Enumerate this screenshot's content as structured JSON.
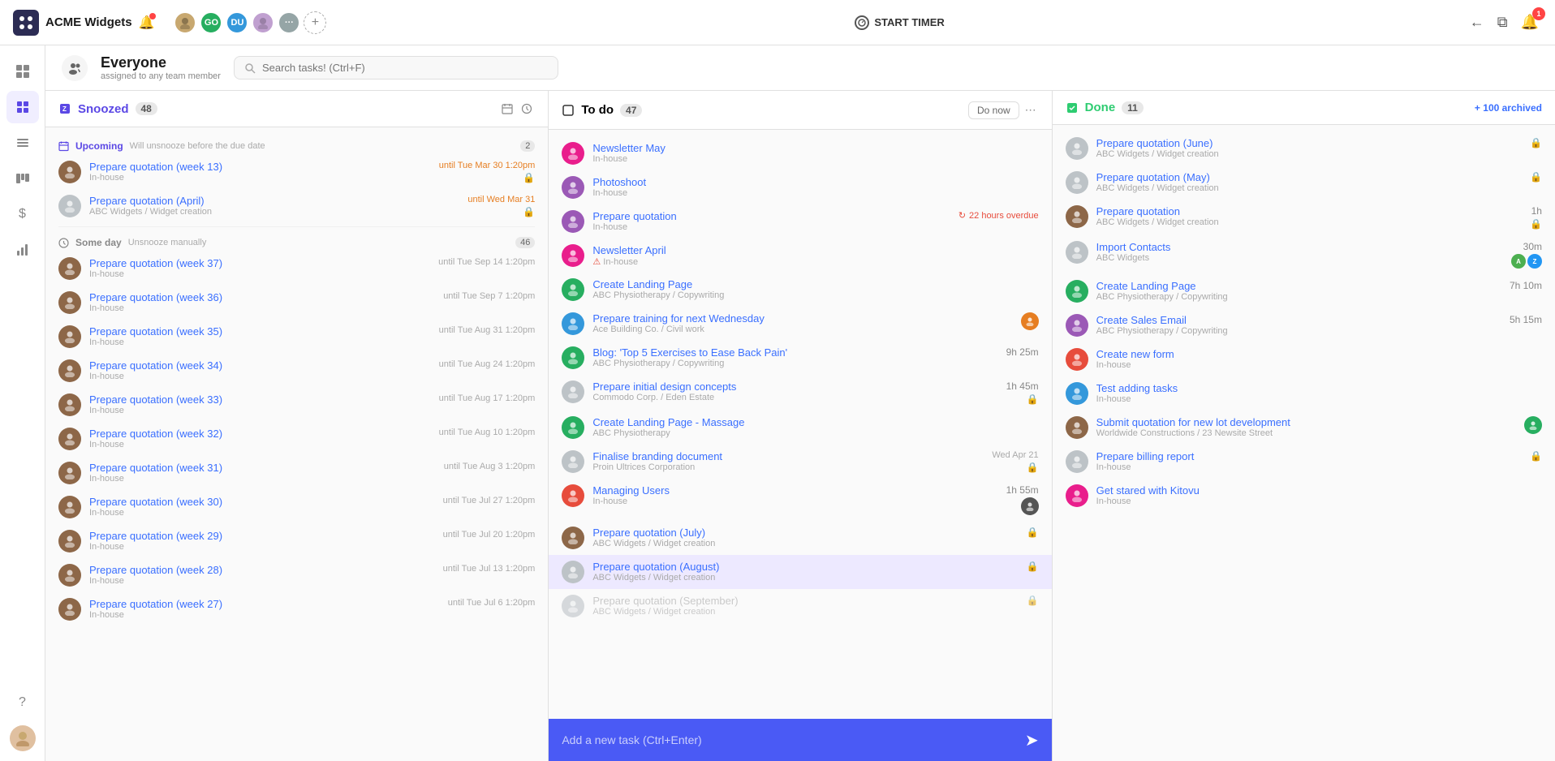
{
  "app": {
    "name": "ACME Widgets",
    "timer_label": "START TIMER",
    "notification_count": "1"
  },
  "topbar": {
    "avatars": [
      {
        "initials": "",
        "color": "#e8c49a",
        "type": "img"
      },
      {
        "initials": "GO",
        "color": "#4caf50"
      },
      {
        "initials": "DU",
        "color": "#2196f3"
      },
      {
        "initials": "",
        "color": "#c0a0d0",
        "type": "img"
      },
      {
        "initials": "...",
        "color": "#bbb"
      }
    ],
    "back_label": "←",
    "bookmark_label": "🔖"
  },
  "view": {
    "title": "Everyone",
    "subtitle": "assigned to any team member",
    "search_placeholder": "Search tasks! (Ctrl+F)"
  },
  "snoozed_column": {
    "title": "Snoozed",
    "count": "48",
    "sections": [
      {
        "id": "upcoming",
        "title": "Upcoming",
        "subtitle": "Will unsnooze before the due date",
        "count": "2",
        "tasks": [
          {
            "name": "Prepare quotation (week 13)",
            "sub": "In-house",
            "date": "until Tue Mar 30 1:20pm",
            "date_color": "orange",
            "lock": true,
            "avatar_color": "#8d6748"
          },
          {
            "name": "Prepare quotation (April)",
            "sub": "ABC Widgets / Widget creation",
            "date": "until Wed Mar 31",
            "date_color": "orange",
            "lock": true,
            "avatar_color": "#bdc3c7"
          }
        ]
      },
      {
        "id": "someday",
        "title": "Some day",
        "subtitle": "Unsnooze manually",
        "count": "46",
        "tasks": [
          {
            "name": "Prepare quotation (week 37)",
            "sub": "In-house",
            "date": "until Tue Sep 14 1:20pm",
            "avatar_color": "#8d6748"
          },
          {
            "name": "Prepare quotation (week 36)",
            "sub": "In-house",
            "date": "until Tue Sep 7 1:20pm",
            "avatar_color": "#8d6748"
          },
          {
            "name": "Prepare quotation (week 35)",
            "sub": "In-house",
            "date": "until Tue Aug 31 1:20pm",
            "avatar_color": "#8d6748"
          },
          {
            "name": "Prepare quotation (week 34)",
            "sub": "In-house",
            "date": "until Tue Aug 24 1:20pm",
            "avatar_color": "#8d6748"
          },
          {
            "name": "Prepare quotation (week 33)",
            "sub": "In-house",
            "date": "until Tue Aug 17 1:20pm",
            "avatar_color": "#8d6748"
          },
          {
            "name": "Prepare quotation (week 32)",
            "sub": "In-house",
            "date": "until Tue Aug 10 1:20pm",
            "avatar_color": "#8d6748"
          },
          {
            "name": "Prepare quotation (week 31)",
            "sub": "In-house",
            "date": "until Tue Aug 3 1:20pm",
            "avatar_color": "#8d6748"
          },
          {
            "name": "Prepare quotation (week 30)",
            "sub": "In-house",
            "date": "until Tue Jul 27 1:20pm",
            "avatar_color": "#8d6748"
          },
          {
            "name": "Prepare quotation (week 29)",
            "sub": "In-house",
            "date": "until Tue Jul 20 1:20pm",
            "avatar_color": "#8d6748"
          },
          {
            "name": "Prepare quotation (week 28)",
            "sub": "In-house",
            "date": "until Tue Jul 13 1:20pm",
            "avatar_color": "#8d6748"
          },
          {
            "name": "Prepare quotation (week 27)",
            "sub": "In-house",
            "date": "until Tue Jul 6 1:20pm",
            "avatar_color": "#8d6748"
          }
        ]
      }
    ]
  },
  "todo_column": {
    "title": "To do",
    "count": "47",
    "do_now_label": "Do now",
    "tasks": [
      {
        "name": "Newsletter May",
        "sub": "In-house",
        "avatar_color": "#e91e8c",
        "overdue": false
      },
      {
        "name": "Photoshoot",
        "sub": "In-house",
        "avatar_color": "#9b59b6",
        "overdue": false
      },
      {
        "name": "Prepare quotation",
        "sub": "In-house",
        "overdue": true,
        "overdue_text": "22 hours overdue",
        "avatar_color": "#9b59b6"
      },
      {
        "name": "Newsletter April",
        "sub": "In-house",
        "warning": true,
        "avatar_color": "#e91e8c"
      },
      {
        "name": "Create Landing Page",
        "sub": "ABC Physiotherapy / Copywriting",
        "avatar_color": "#27ae60"
      },
      {
        "name": "Prepare training for next Wednesday",
        "sub": "Ace Building Co. / Civil work",
        "avatar_color": "#3498db",
        "has_avatar_tag": true,
        "tag_color": "#e67e22"
      },
      {
        "name": "Blog: 'Top 5 Exercises to Ease Back Pain'",
        "sub": "ABC Physiotherapy / Copywriting",
        "time": "9h 25m",
        "avatar_color": "#27ae60"
      },
      {
        "name": "Prepare initial design concepts",
        "sub": "Commodo Corp. / Eden Estate",
        "time": "1h 45m",
        "avatar_color": "#bdc3c7",
        "lock": true
      },
      {
        "name": "Create Landing Page - Massage",
        "sub": "ABC Physiotherapy",
        "avatar_color": "#27ae60"
      },
      {
        "name": "Finalise branding document",
        "sub": "Proin Ultrices Corporation",
        "date": "Wed Apr 21",
        "avatar_color": "#bdc3c7",
        "lock": true
      },
      {
        "name": "Managing Users",
        "sub": "In-house",
        "time": "1h 55m",
        "avatar_color": "#e74c3c",
        "has_avatar_tag": true,
        "tag_color": "#555"
      },
      {
        "name": "Prepare quotation (July)",
        "sub": "ABC Widgets / Widget creation",
        "avatar_color": "#8d6748",
        "lock": true
      },
      {
        "name": "Prepare quotation (August)",
        "sub": "ABC Widgets / Widget creation",
        "avatar_color": "#bdc3c7",
        "lock": true,
        "highlighted": true
      },
      {
        "name": "Prepare quotation (September)",
        "sub": "ABC Widgets / Widget creation",
        "avatar_color": "#bdc3c7",
        "lock": true
      }
    ]
  },
  "done_column": {
    "title": "Done",
    "count": "11",
    "archived_label": "+ 100 archived",
    "tasks": [
      {
        "name": "Prepare quotation (June)",
        "sub": "ABC Widgets / Widget creation",
        "lock": true,
        "avatar_color": "#bdc3c7"
      },
      {
        "name": "Prepare quotation (May)",
        "sub": "ABC Widgets / Widget creation",
        "lock": true,
        "avatar_color": "#bdc3c7"
      },
      {
        "name": "Prepare quotation",
        "sub": "ABC Widgets / Widget creation",
        "time": "1h",
        "lock": true,
        "avatar_color": "#8d6748"
      },
      {
        "name": "Import Contacts",
        "sub": "ABC Widgets",
        "time": "30m",
        "has_inline_avatars": true,
        "avatar_color": "#bdc3c7"
      },
      {
        "name": "Create Landing Page",
        "sub": "ABC Physiotherapy / Copywriting",
        "time": "7h 10m",
        "avatar_color": "#27ae60"
      },
      {
        "name": "Create Sales Email",
        "sub": "ABC Physiotherapy / Copywriting",
        "time": "5h 15m",
        "avatar_color": "#9b59b6"
      },
      {
        "name": "Create new form",
        "sub": "In-house",
        "avatar_color": "#e74c3c"
      },
      {
        "name": "Test adding tasks",
        "sub": "In-house",
        "avatar_color": "#3498db"
      },
      {
        "name": "Submit quotation for new lot development",
        "sub": "Worldwide Constructions / 23 Newsite Street",
        "avatar_color": "#8d6748",
        "has_avatar_tag": true,
        "tag_color": "#27ae60"
      },
      {
        "name": "Prepare billing report",
        "sub": "In-house",
        "lock": true,
        "avatar_color": "#bdc3c7"
      },
      {
        "name": "Get stared with Kitovu",
        "sub": "In-house",
        "avatar_color": "#e91e8c"
      }
    ]
  },
  "add_task": {
    "placeholder": "Add a new task (Ctrl+Enter)",
    "send_icon": "➤"
  },
  "sidebar": {
    "items": [
      {
        "icon": "⊞",
        "name": "grid",
        "active": false
      },
      {
        "icon": "◎",
        "name": "timer",
        "active": true
      },
      {
        "icon": "☰",
        "name": "list",
        "active": false
      },
      {
        "icon": "📋",
        "name": "board",
        "active": false
      },
      {
        "icon": "$",
        "name": "billing",
        "active": false
      },
      {
        "icon": "📊",
        "name": "reports",
        "active": false
      }
    ]
  }
}
